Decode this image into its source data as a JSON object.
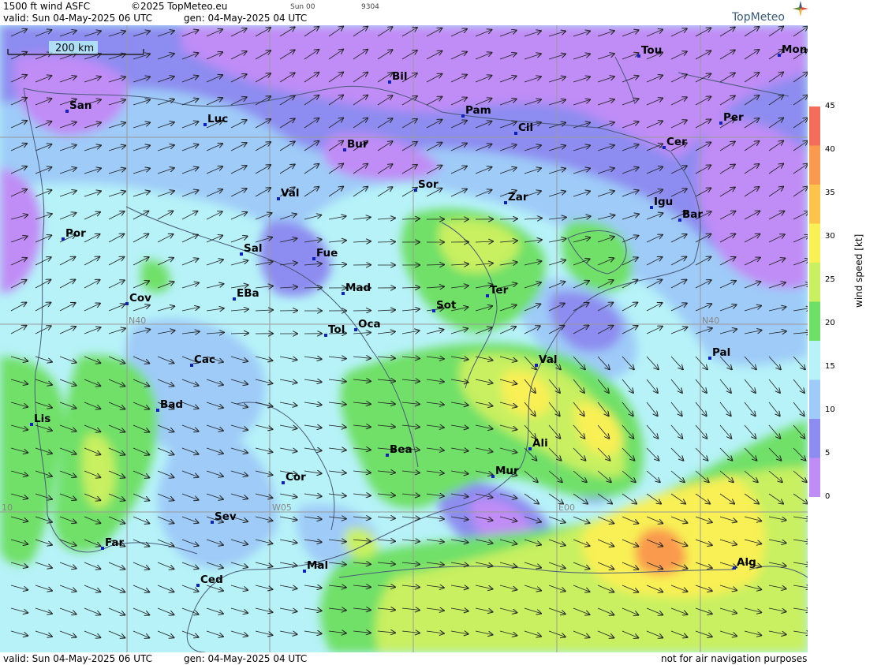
{
  "header": {
    "line1_left": "1500 ft wind ASFC",
    "copyright": "©2025 TopMeteo.eu",
    "run_code": "Sun 00",
    "code2": "9304",
    "line2_valid": "valid:  Sun  04-May-2025  06 UTC",
    "line2_gen": "gen: 04-May-2025 04 UTC",
    "logo_text": "TopMeteo"
  },
  "footer": {
    "valid": "valid:  Sun  04-May-2025  06 UTC",
    "gen": "gen: 04-May-2025 04 UTC",
    "disclaimer": "not for air navigation purposes"
  },
  "scale_bar": {
    "label": "200 km"
  },
  "colorbar": {
    "label": "wind speed [kt]",
    "ticks": [
      "45",
      "40",
      "35",
      "30",
      "25",
      "20",
      "15",
      "10",
      "5",
      "0"
    ],
    "colors": [
      "#f46d5a",
      "#fa9a4e",
      "#fcc44a",
      "#f8f054",
      "#c8f060",
      "#6fe067",
      "#b6f2f8",
      "#9ecbf8",
      "#8d8cf0",
      "#c08cf6"
    ]
  },
  "grid_labels": {
    "n40_left": "N40",
    "n40_right": "N40",
    "w05": "W05",
    "e00": "E00",
    "w10": "10"
  },
  "cities": [
    {
      "name": "Bil"
    },
    {
      "name": "Tou"
    },
    {
      "name": "Mon"
    },
    {
      "name": "San"
    },
    {
      "name": "Pam"
    },
    {
      "name": "Luc"
    },
    {
      "name": "Per"
    },
    {
      "name": "Cil"
    },
    {
      "name": "Cer"
    },
    {
      "name": "Bur"
    },
    {
      "name": "Sor"
    },
    {
      "name": "Zar"
    },
    {
      "name": "Val"
    },
    {
      "name": "Igu"
    },
    {
      "name": "Bar"
    },
    {
      "name": "Por"
    },
    {
      "name": "Sal"
    },
    {
      "name": "Fue"
    },
    {
      "name": "Mad"
    },
    {
      "name": "EBa"
    },
    {
      "name": "Cov"
    },
    {
      "name": "Sot"
    },
    {
      "name": "Ter"
    },
    {
      "name": "Tol"
    },
    {
      "name": "Oca"
    },
    {
      "name": "Pal"
    },
    {
      "name": "Cac"
    },
    {
      "name": "Val"
    },
    {
      "name": "Bad"
    },
    {
      "name": "Lis"
    },
    {
      "name": "Ali"
    },
    {
      "name": "Bea"
    },
    {
      "name": "Mur"
    },
    {
      "name": "Cor"
    },
    {
      "name": "Sev"
    },
    {
      "name": "Far"
    },
    {
      "name": "Alg"
    },
    {
      "name": "Mal"
    },
    {
      "name": "Ced"
    }
  ]
}
